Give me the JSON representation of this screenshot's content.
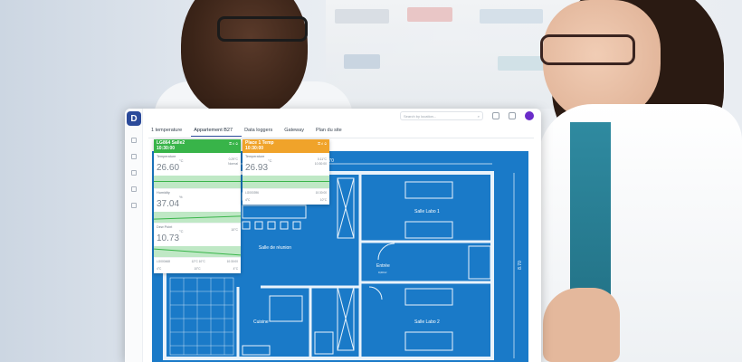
{
  "app": {
    "logo_letter": "D",
    "search_placeholder": "Search by location...",
    "tabs": [
      {
        "label": "1 temperature",
        "active": false
      },
      {
        "label": "Appartement B27",
        "active": true
      },
      {
        "label": "Data loggers",
        "active": false
      },
      {
        "label": "Gateway",
        "active": false
      },
      {
        "label": "Plan du site",
        "active": false
      }
    ],
    "accent": "#2b4a9a",
    "avatar_color": "#6a2cc9"
  },
  "plan": {
    "background": "#1a7ac8",
    "dimension_top": "9.70",
    "dimension_side": "8.70",
    "rooms": {
      "salle_labo_1": "Salle Labo 1",
      "salle_reunion": "Salle de réunion",
      "entree": "Entrée",
      "entree_area": "0,00m²",
      "cuisine": "Cuisine",
      "salle_labo_2": "Salle Labo 2"
    }
  },
  "cards": [
    {
      "name": "LG864 Salle2",
      "time": "10:30:00",
      "header_icons": "⚿ ıl ⊙",
      "color": "#38b449",
      "metrics": [
        {
          "label": "Temperature",
          "value": "26.60",
          "unit": "°C",
          "right_top": "0.29°C",
          "right_bottom": "Normal"
        },
        {
          "label": "Humidity",
          "value": "37.04",
          "unit": "%",
          "right_top": "",
          "right_bottom": ""
        },
        {
          "label": "Dew Point",
          "value": "10.73",
          "unit": "°C",
          "right_top": "10°C",
          "right_bottom": ""
        }
      ],
      "footer_mid": "12°C  10°C",
      "footer_1": "LG000468",
      "footer_2": "10:30:00",
      "footer_3": "4°C",
      "footer_4": "10°C",
      "footer_5": "4°C"
    },
    {
      "name": "Place 1 Temp",
      "time": "10:30:00",
      "header_icons": "⚿ ıl ⊙",
      "color": "#f0a32a",
      "metrics": [
        {
          "label": "Temperature",
          "value": "26.93",
          "unit": "°C",
          "right_top": "0.11°C",
          "right_bottom": "10:30:00"
        }
      ],
      "footer_1": "LG000396",
      "footer_2": "10:30:00",
      "footer_3": "4°C",
      "footer_4": "10°C"
    }
  ]
}
